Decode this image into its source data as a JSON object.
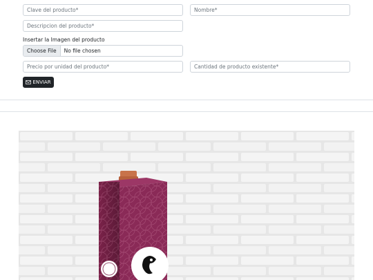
{
  "form": {
    "clave_placeholder": "Clave del producto*",
    "nombre_placeholder": "Nombre*",
    "descripcion_placeholder": "Descripcion del producto*",
    "imagen_label": "Insertar la Imagen del producto",
    "file_button": "Choose File",
    "file_status": "No file chosen",
    "precio_placeholder": "Precio por unidad del producto*",
    "cantidad_placeholder": "Cantidad de producto existente*",
    "submit_label": "ENVIAR"
  },
  "product_image": {
    "package_color": "#8a2a57",
    "cap_color": "#c8734a",
    "wall_color": "#e4e4e4"
  }
}
